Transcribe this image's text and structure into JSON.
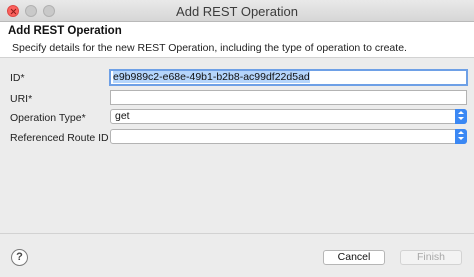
{
  "window": {
    "title": "Add REST Operation"
  },
  "header": {
    "title": "Add REST Operation",
    "description": "Specify details for the new REST Operation, including the type of operation to create."
  },
  "form": {
    "id": {
      "label": "ID*",
      "value": "e9b989c2-e68e-49b1-b2b8-ac99df22d5ad"
    },
    "uri": {
      "label": "URI*",
      "value": ""
    },
    "operation_type": {
      "label": "Operation Type*",
      "value": "get"
    },
    "route_id": {
      "label": "Referenced Route ID",
      "value": ""
    }
  },
  "buttons": {
    "help": "?",
    "cancel": "Cancel",
    "finish": "Finish"
  },
  "colors": {
    "accent": "#3b88f4",
    "focus_ring": "#6ea0e6",
    "selection": "#b5d5fb",
    "close_button": "#fc615d"
  }
}
